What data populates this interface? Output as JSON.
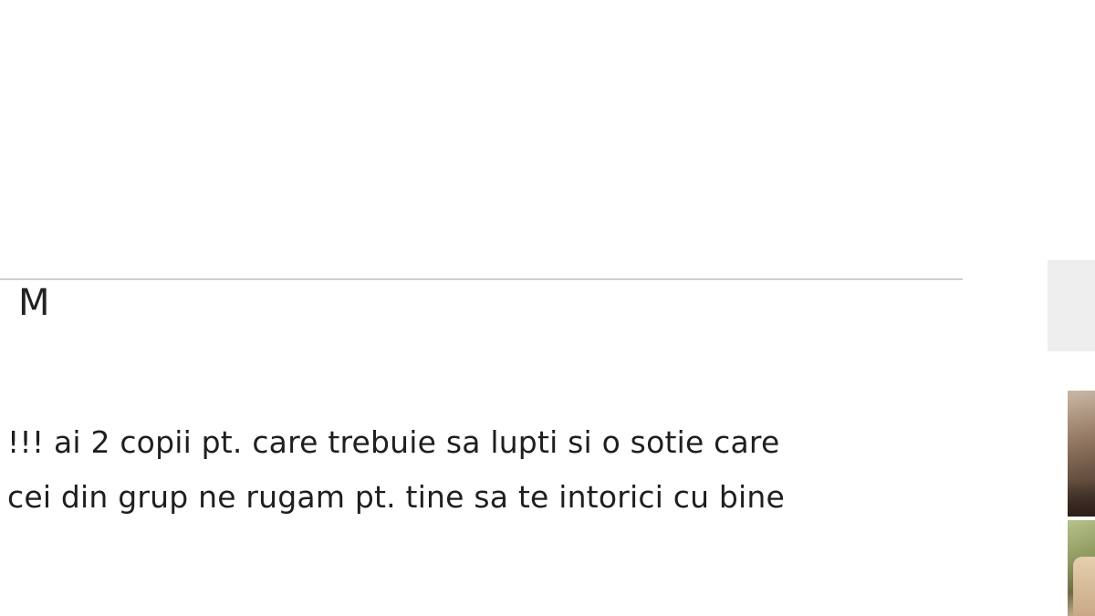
{
  "post": {
    "lines": [
      "!!! ai 2 copii pt. care trebuie sa lupti si o sotie care",
      "cei din grup ne rugam pt. tine sa te intorici cu bine"
    ]
  },
  "sidebar": {
    "tab_label": "M",
    "thumbnails": [
      {
        "name": "profile-photo-1"
      },
      {
        "name": "profile-photo-2"
      }
    ]
  }
}
